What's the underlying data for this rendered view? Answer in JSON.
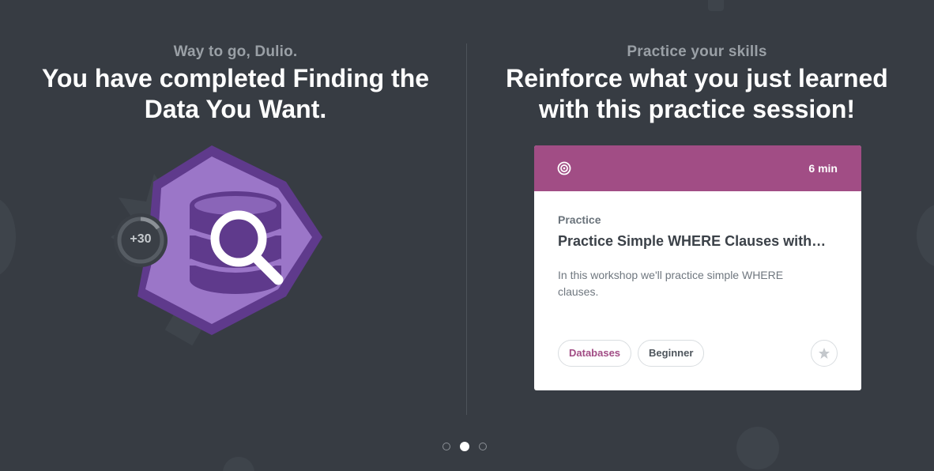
{
  "left_panel": {
    "eyebrow": "Way to go, Dulio.",
    "headline": "You have completed Finding the Data You Want.",
    "badge": {
      "icon": "database-search-icon",
      "points_label": "+30"
    }
  },
  "right_panel": {
    "eyebrow": "Practice your skills",
    "headline": "Reinforce what you just learned with this practice session!"
  },
  "card": {
    "header_icon": "target-icon",
    "duration": "6 min",
    "type": "Practice",
    "title": "Practice Simple WHERE Clauses with…",
    "description": "In this workshop we'll practice simple WHERE clauses.",
    "tags": [
      {
        "label": "Databases"
      },
      {
        "label": "Beginner"
      }
    ],
    "bookmark_icon": "star-icon"
  },
  "pagination": {
    "pages": 3,
    "active_page": 2
  },
  "colors": {
    "background": "#373c43",
    "card_header": "#a14d85",
    "badge_purple": "#9b76c8",
    "badge_dark": "#5f3a8c"
  }
}
